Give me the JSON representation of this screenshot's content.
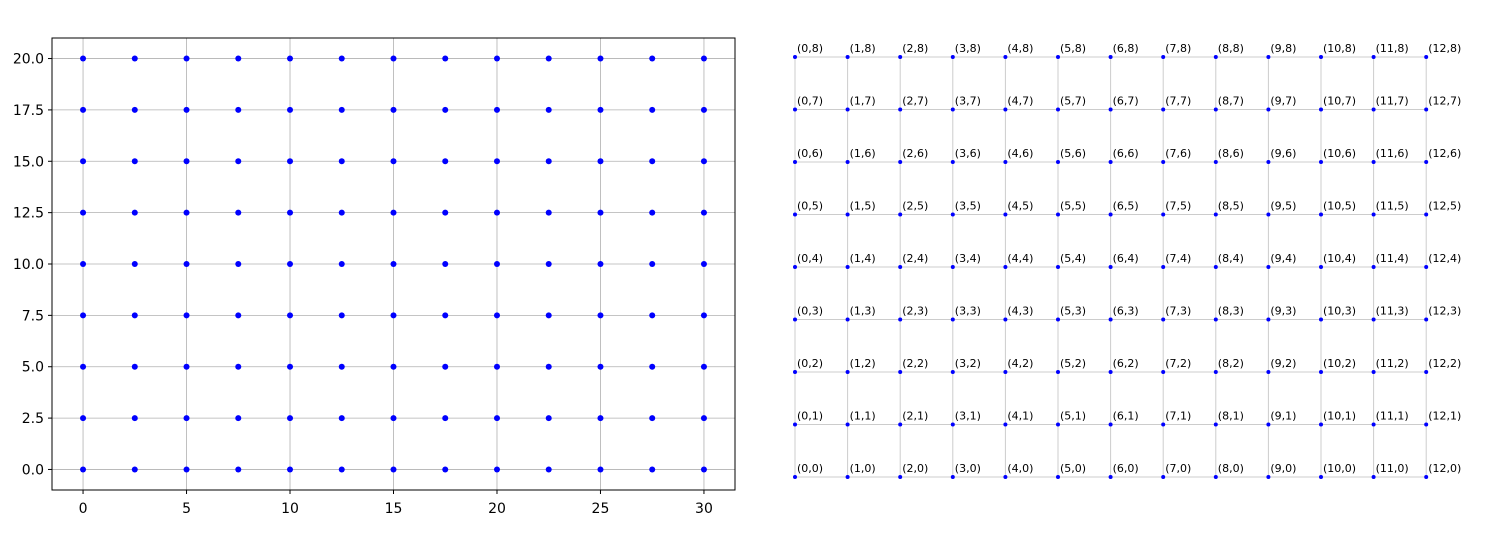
{
  "chart_data": [
    {
      "type": "scatter",
      "title": "",
      "xlabel": "",
      "ylabel": "",
      "xlim": [
        -1.5,
        31.5
      ],
      "ylim": [
        -1.0,
        21.0
      ],
      "grid": true,
      "marker_color": "#0000ff",
      "x_ticks": [
        "0",
        "5",
        "10",
        "15",
        "20",
        "25",
        "30"
      ],
      "y_ticks": [
        "0.0",
        "2.5",
        "5.0",
        "7.5",
        "10.0",
        "12.5",
        "15.0",
        "17.5",
        "20.0"
      ],
      "x_values": [
        0,
        2.5,
        5,
        7.5,
        10,
        12.5,
        15,
        17.5,
        20,
        22.5,
        25,
        27.5,
        30
      ],
      "y_values": [
        0,
        2.5,
        5,
        7.5,
        10,
        12.5,
        15,
        17.5,
        20
      ]
    },
    {
      "type": "scatter",
      "title": "",
      "axes_visible": false,
      "grid": true,
      "marker_color": "#0000ff",
      "columns": 13,
      "rows": 9,
      "label_format": "(col,row)"
    }
  ]
}
